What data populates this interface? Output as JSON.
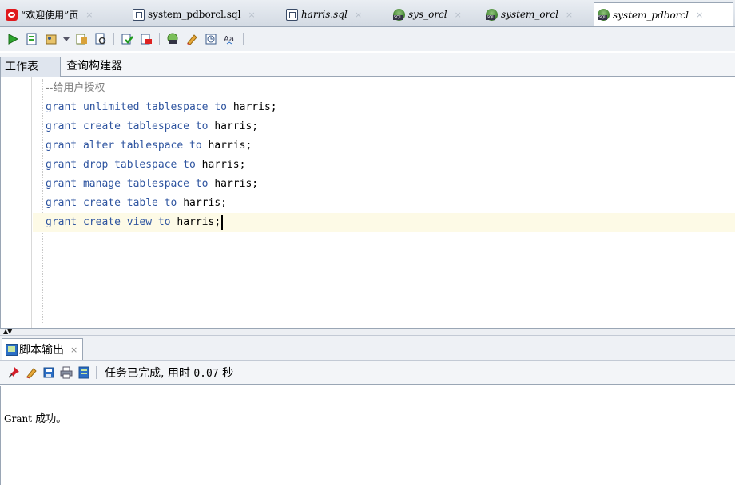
{
  "tabs": [
    {
      "label": "“欢迎使用”页",
      "icon": "oracle-logo-icon",
      "active": false
    },
    {
      "label": "system_pdborcl.sql",
      "icon": "sql-file-icon",
      "active": false
    },
    {
      "label": "harris.sql",
      "icon": "sql-file-icon",
      "active": false
    },
    {
      "label": "sys_orcl",
      "icon": "sql-connection-icon",
      "active": false
    },
    {
      "label": "system_orcl",
      "icon": "sql-connection-icon",
      "active": false
    },
    {
      "label": "system_pdborcl",
      "icon": "sql-connection-icon",
      "active": true
    }
  ],
  "toolbar": {
    "icons": [
      "run-statement-icon",
      "run-script-icon",
      "commit-icon",
      "dropdown-arrow-icon",
      "autotrace-icon",
      "explain-plan-icon",
      "commit-green-icon",
      "rollback-icon",
      "sql-tuning-icon",
      "clear-eraser-icon",
      "history-icon",
      "format-text-icon"
    ]
  },
  "subtabs": {
    "worksheet": "工作表",
    "query_builder": "查询构建器"
  },
  "editor": {
    "comment": "--给用户授权",
    "lines": [
      {
        "kw": "grant unlimited tablespace to ",
        "target": "harris;"
      },
      {
        "kw": "grant create tablespace to ",
        "target": "harris;"
      },
      {
        "kw": "grant alter tablespace to ",
        "target": "harris;"
      },
      {
        "kw": "grant drop tablespace to ",
        "target": "harris;"
      },
      {
        "kw": "grant manage tablespace to ",
        "target": "harris;"
      },
      {
        "kw": "grant create table to ",
        "target": "harris;"
      },
      {
        "kw": "grant create view to ",
        "target": "harris;"
      }
    ]
  },
  "output_panel": {
    "tab_label": "脚本输出",
    "status": {
      "prefix": "任务已完成, 用时 ",
      "time": "0.07",
      "unit": " 秒"
    },
    "result": {
      "keyword": "Grant",
      "message": " 成功。"
    }
  },
  "colors": {
    "keyword": "#2f55a0",
    "comment": "#808080",
    "current_line": "#fdfae6",
    "tab_strip": "#d3dae3"
  }
}
